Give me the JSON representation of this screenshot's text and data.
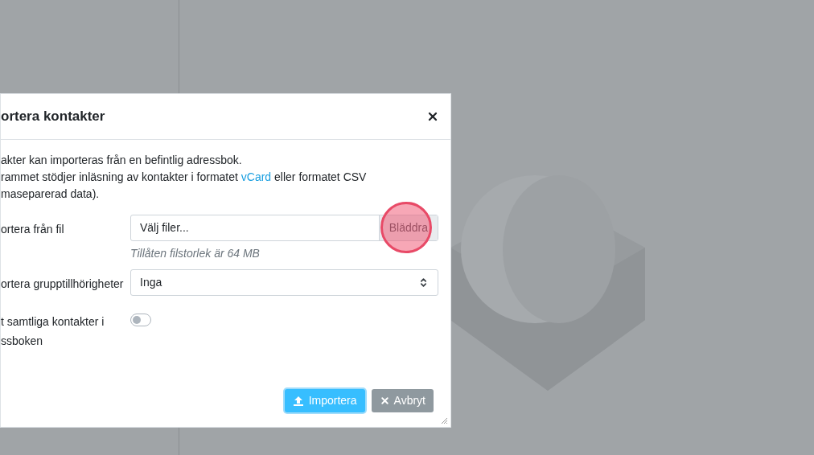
{
  "dialog": {
    "title": "ortera kontakter",
    "intro": {
      "line_1": "akter kan importeras från en befintlig adressbok.",
      "line_2_before": "rammet stödjer inläsning av kontakter i formatet ",
      "link": "vCard",
      "line_2_after": " eller formatet CSV",
      "line_3": "maseparerad data)."
    },
    "fields": [
      {
        "kind": "file",
        "label": "ortera från fil",
        "placeholder": "Välj filer...",
        "button": "Bläddra",
        "hint": "Tillåten filstorlek är 64 MB"
      },
      {
        "kind": "select",
        "label": "ortera grupptillhörigheter",
        "value": "Inga"
      },
      {
        "kind": "toggle",
        "label": "t samtliga kontakter i\nssboken",
        "on": false
      }
    ],
    "buttons": [
      {
        "kind": "primary",
        "label": "Importera"
      },
      {
        "kind": "secondary",
        "label": "Avbryt"
      }
    ]
  }
}
